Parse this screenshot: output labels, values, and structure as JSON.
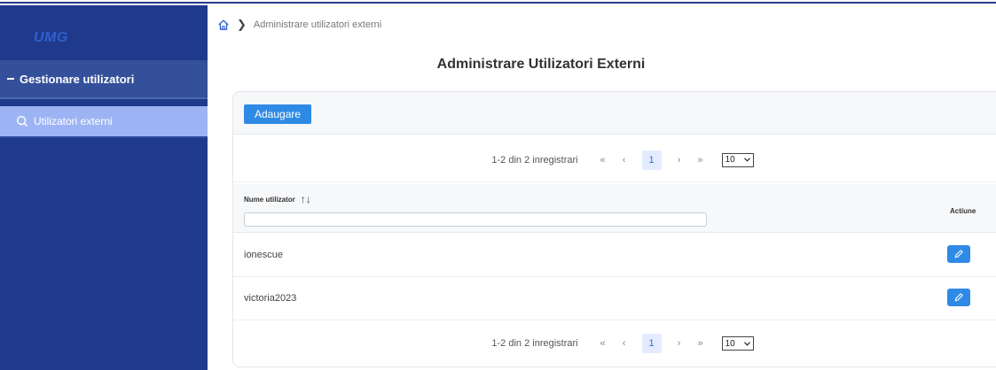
{
  "app": {
    "logo": "UMG"
  },
  "sidebar": {
    "group_label": "Gestionare utilizatori",
    "items": [
      {
        "label": "Utilizatori externi",
        "icon": "search-icon"
      }
    ]
  },
  "breadcrumb": {
    "home_icon": "home-icon",
    "current": "Administrare utilizatori externi"
  },
  "page": {
    "title": "Administrare Utilizatori Externi"
  },
  "toolbar": {
    "add_label": "Adaugare"
  },
  "paginator": {
    "info": "1-2 din 2 inregistrari",
    "first": "«",
    "prev": "‹",
    "page": "1",
    "next": "›",
    "last": "»",
    "page_size": "10"
  },
  "table": {
    "columns": {
      "username": "Nume utilizator",
      "actions": "Actiune"
    },
    "rows": [
      {
        "username": "ionescue"
      },
      {
        "username": "victoria2023"
      }
    ]
  },
  "colors": {
    "sidebar": "#1f3a8a",
    "accent": "#2f8ae6",
    "active_item": "#9db4f4"
  }
}
